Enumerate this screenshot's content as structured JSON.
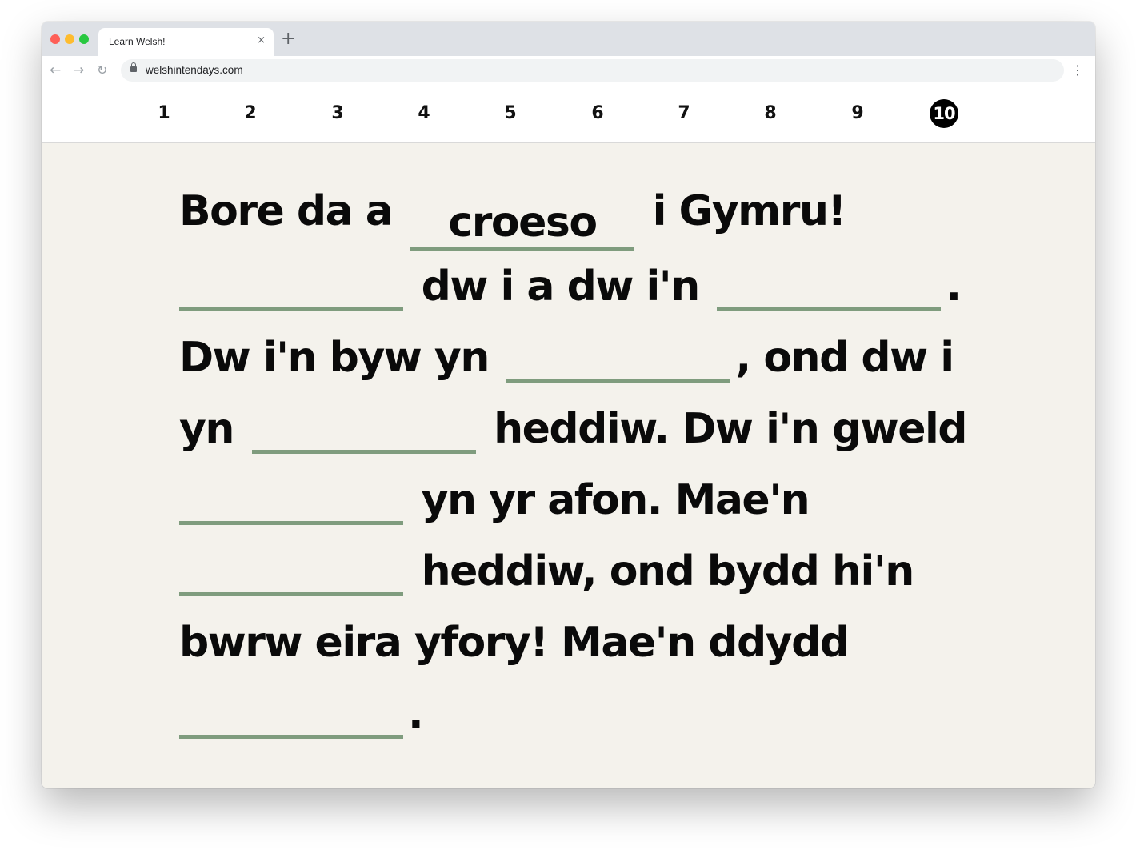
{
  "browser": {
    "tab_title": "Learn Welsh!",
    "tab_close": "×",
    "new_tab": "+",
    "url": "welshintendays.com",
    "back": "←",
    "forward": "→",
    "reload": "↻",
    "menu": "⋮"
  },
  "page_nav": {
    "items": [
      "1",
      "2",
      "3",
      "4",
      "5",
      "6",
      "7",
      "8",
      "9",
      "10"
    ],
    "active": "10"
  },
  "exercise": {
    "segments": [
      "Bore da a",
      "i Gymru!",
      "dw i a dw i'n",
      ".",
      "Dw i'n byw yn",
      ", ond dw i",
      "yn",
      "heddiw. Dw i'n gweld",
      "yn yr afon. Mae'n",
      "heddiw, ond bydd hi'n",
      "bwrw eira yfory! Mae'n ddydd",
      "."
    ],
    "blanks": [
      "croeso",
      "",
      "",
      "",
      "",
      "",
      "",
      ""
    ]
  },
  "colors": {
    "blank_underline": "#7f9c7e",
    "page_background": "#f4f2ec",
    "active_nav": "#000000"
  }
}
